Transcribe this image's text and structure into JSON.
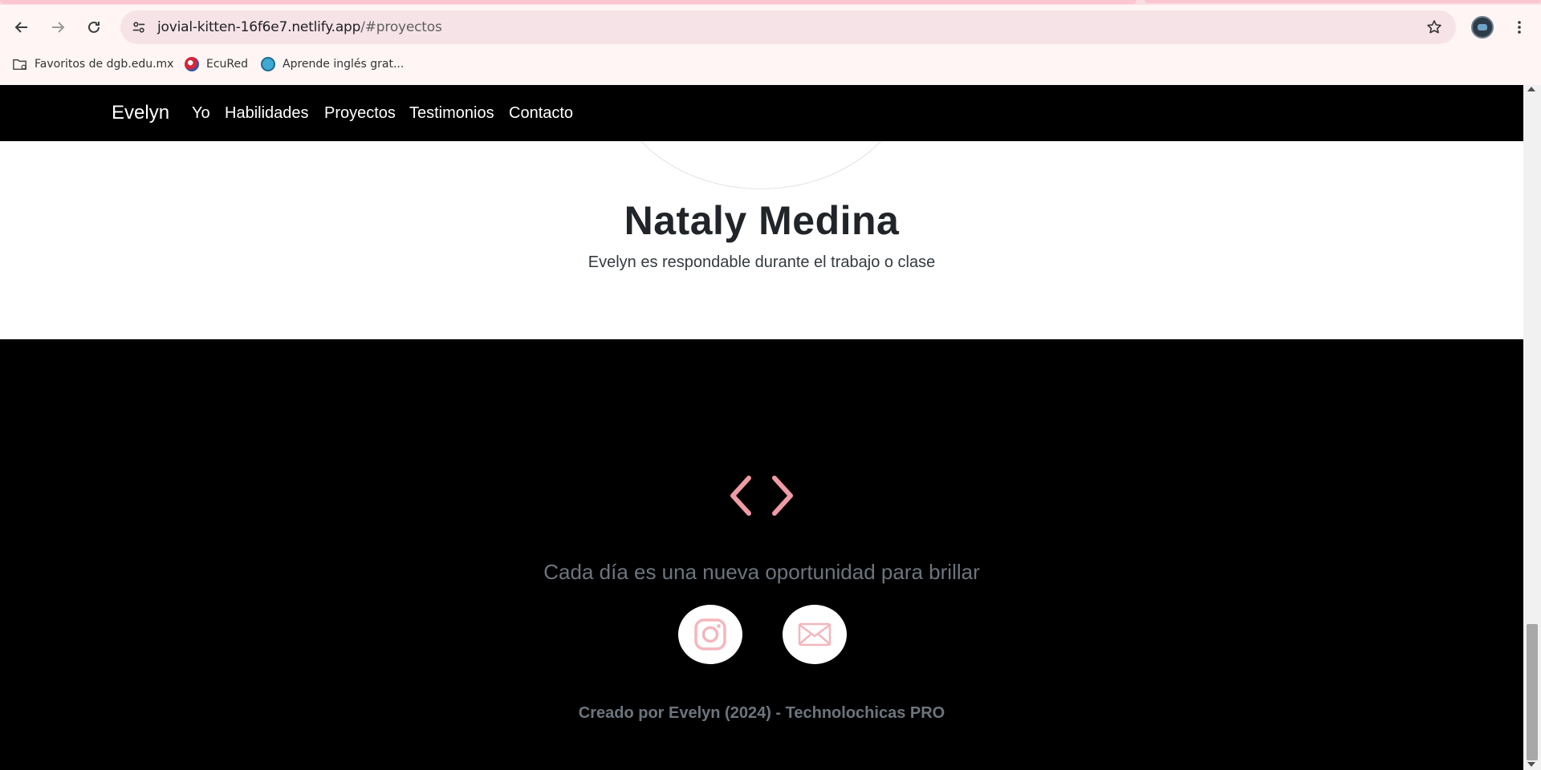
{
  "browser": {
    "url_host": "jovial-kitten-16f6e7.netlify.app",
    "url_path": "/#proyectos",
    "bookmarks": [
      {
        "label": "Favoritos de dgb.edu.mx",
        "icon": "folder-icon"
      },
      {
        "label": "EcuRed",
        "icon": "ecured-icon"
      },
      {
        "label": "Aprende inglés grat...",
        "icon": "globe-icon"
      }
    ]
  },
  "nav": {
    "brand": "Evelyn",
    "links": [
      "Yo",
      "Habilidades",
      "Proyectos",
      "Testimonios",
      "Contacto"
    ]
  },
  "testimonial": {
    "name": "Nataly Medina",
    "text": "Evelyn es respondable durante el trabajo o clase"
  },
  "footer": {
    "icon": "code-icon",
    "quote": "Cada día es una nueva oportunidad para brillar",
    "social": [
      {
        "name": "instagram",
        "icon": "instagram-icon"
      },
      {
        "name": "email",
        "icon": "envelope-icon"
      }
    ],
    "credits": "Creado por Evelyn (2024) - Technolochicas PRO"
  },
  "colors": {
    "accent": "#ee9ba5",
    "social_icon": "#f4b6bd",
    "footer_text": "#6c757d",
    "nav_bg": "#000000"
  }
}
